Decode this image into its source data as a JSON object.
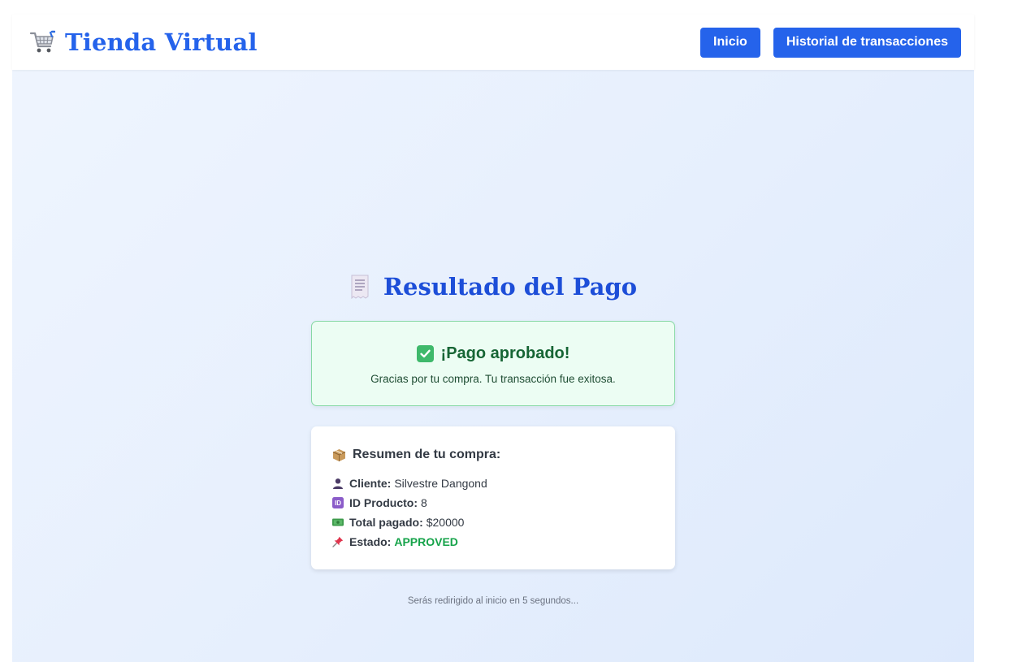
{
  "header": {
    "brand_title": "Tienda Virtual",
    "brand_icon": "shopping-cart-icon",
    "nav": {
      "home_label": "Inicio",
      "history_label": "Historial de transacciones"
    }
  },
  "main": {
    "page_title": "Resultado del Pago",
    "title_icon": "receipt-icon",
    "result": {
      "title": "¡Pago aprobado!",
      "message": "Gracias por tu compra. Tu transacción fue exitosa.",
      "icon": "check-box-icon"
    },
    "summary": {
      "title": "Resumen de tu compra:",
      "icon": "package-icon",
      "rows": [
        {
          "label": "Cliente:",
          "value": "Silvestre Dangond",
          "icon": "person-icon"
        },
        {
          "label": "ID Producto:",
          "value": "8",
          "icon": "id-icon"
        },
        {
          "label": "Total pagado:",
          "value": "$20000",
          "icon": "money-icon"
        },
        {
          "label": "Estado:",
          "value": "APPROVED",
          "icon": "pin-icon"
        }
      ]
    },
    "redirect_text": "Serás redirigido al inicio en 5 segundos..."
  },
  "colors": {
    "brand": "#2563eb",
    "title": "#1d4ed8",
    "success_bg": "#ecfdf3",
    "success_border": "#86d8a4",
    "success_text": "#166534",
    "approved": "#16a34a"
  }
}
